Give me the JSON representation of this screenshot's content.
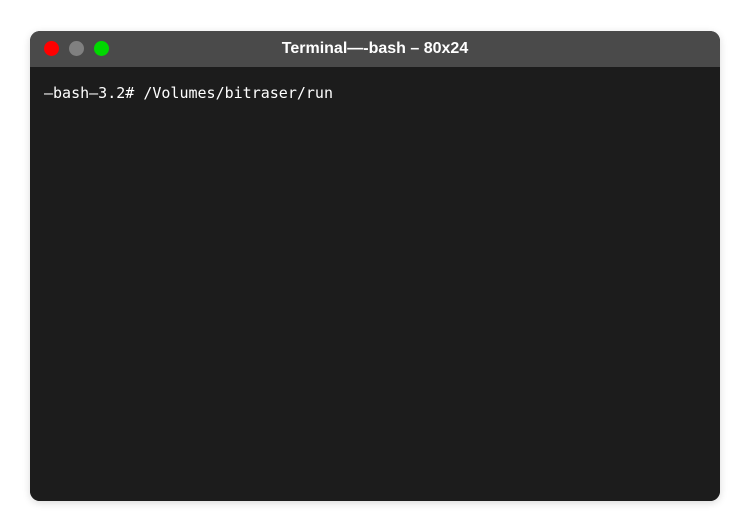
{
  "window": {
    "title": "Terminal—-bash – 80x24"
  },
  "terminal": {
    "line1": "–bash–3.2# /Volumes/bitraser/run"
  },
  "colors": {
    "title_bar": "#4a4a4a",
    "body": "#1c1c1c",
    "text": "#ffffff",
    "close": "#ff0000",
    "minimize": "#808080",
    "maximize": "#00d800"
  }
}
